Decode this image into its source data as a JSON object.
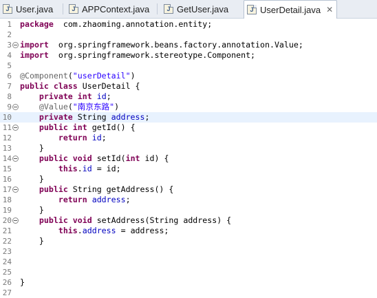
{
  "tabs": [
    {
      "label": "User.java",
      "active": false
    },
    {
      "label": "APPContext.java",
      "active": false
    },
    {
      "label": "GetUser.java",
      "active": false
    },
    {
      "label": "UserDetail.java",
      "active": true
    }
  ],
  "tab_icon_letter": "J",
  "close_glyph": "✕",
  "current_line": 10,
  "lines": [
    {
      "n": "1",
      "fold": false,
      "t": [
        [
          "kw",
          "package"
        ],
        [
          "",
          "  com.zhaoming.annotation.entity;"
        ]
      ]
    },
    {
      "n": "2",
      "fold": false,
      "t": []
    },
    {
      "n": "3",
      "fold": true,
      "t": [
        [
          "kw",
          "import"
        ],
        [
          "",
          "  org.springframework.beans.factory.annotation.Value;"
        ]
      ]
    },
    {
      "n": "4",
      "fold": false,
      "t": [
        [
          "kw",
          "import"
        ],
        [
          "",
          "  org.springframework.stereotype.Component;"
        ]
      ]
    },
    {
      "n": "5",
      "fold": false,
      "t": []
    },
    {
      "n": "6",
      "fold": false,
      "t": [
        [
          "ann",
          "@Component"
        ],
        [
          "",
          "("
        ],
        [
          "str",
          "\"userDetail\""
        ],
        [
          "",
          ")"
        ]
      ]
    },
    {
      "n": "7",
      "fold": false,
      "t": [
        [
          "kw",
          "public"
        ],
        [
          "",
          " "
        ],
        [
          "kw",
          "class"
        ],
        [
          "",
          " UserDetail {"
        ]
      ]
    },
    {
      "n": "8",
      "fold": false,
      "t": [
        [
          "",
          "    "
        ],
        [
          "kw",
          "private"
        ],
        [
          "",
          " "
        ],
        [
          "kw",
          "int"
        ],
        [
          "",
          " "
        ],
        [
          "fld",
          "id"
        ],
        [
          "",
          ";"
        ]
      ]
    },
    {
      "n": "9",
      "fold": true,
      "t": [
        [
          "",
          "    "
        ],
        [
          "ann",
          "@Value"
        ],
        [
          "",
          "("
        ],
        [
          "str",
          "\"南京东路\""
        ],
        [
          "",
          ")"
        ]
      ]
    },
    {
      "n": "10",
      "fold": false,
      "t": [
        [
          "",
          "    "
        ],
        [
          "kw",
          "private"
        ],
        [
          "",
          " String "
        ],
        [
          "fld",
          "address"
        ],
        [
          "",
          ";"
        ]
      ]
    },
    {
      "n": "11",
      "fold": true,
      "t": [
        [
          "",
          "    "
        ],
        [
          "kw",
          "public"
        ],
        [
          "",
          " "
        ],
        [
          "kw",
          "int"
        ],
        [
          "",
          " getId() {"
        ]
      ]
    },
    {
      "n": "12",
      "fold": false,
      "t": [
        [
          "",
          "        "
        ],
        [
          "kw",
          "return"
        ],
        [
          "",
          " "
        ],
        [
          "fld",
          "id"
        ],
        [
          "",
          ";"
        ]
      ]
    },
    {
      "n": "13",
      "fold": false,
      "t": [
        [
          "",
          "    }"
        ]
      ]
    },
    {
      "n": "14",
      "fold": true,
      "t": [
        [
          "",
          "    "
        ],
        [
          "kw",
          "public"
        ],
        [
          "",
          " "
        ],
        [
          "kw",
          "void"
        ],
        [
          "",
          " setId("
        ],
        [
          "kw",
          "int"
        ],
        [
          "",
          " id) {"
        ]
      ]
    },
    {
      "n": "15",
      "fold": false,
      "t": [
        [
          "",
          "        "
        ],
        [
          "kw",
          "this"
        ],
        [
          "",
          "."
        ],
        [
          "fld",
          "id"
        ],
        [
          "",
          " = id;"
        ]
      ]
    },
    {
      "n": "16",
      "fold": false,
      "t": [
        [
          "",
          "    }"
        ]
      ]
    },
    {
      "n": "17",
      "fold": true,
      "t": [
        [
          "",
          "    "
        ],
        [
          "kw",
          "public"
        ],
        [
          "",
          " String getAddress() {"
        ]
      ]
    },
    {
      "n": "18",
      "fold": false,
      "t": [
        [
          "",
          "        "
        ],
        [
          "kw",
          "return"
        ],
        [
          "",
          " "
        ],
        [
          "fld",
          "address"
        ],
        [
          "",
          ";"
        ]
      ]
    },
    {
      "n": "19",
      "fold": false,
      "t": [
        [
          "",
          "    }"
        ]
      ]
    },
    {
      "n": "20",
      "fold": true,
      "t": [
        [
          "",
          "    "
        ],
        [
          "kw",
          "public"
        ],
        [
          "",
          " "
        ],
        [
          "kw",
          "void"
        ],
        [
          "",
          " setAddress(String address) {"
        ]
      ]
    },
    {
      "n": "21",
      "fold": false,
      "t": [
        [
          "",
          "        "
        ],
        [
          "kw",
          "this"
        ],
        [
          "",
          "."
        ],
        [
          "fld",
          "address"
        ],
        [
          "",
          " = address;"
        ]
      ]
    },
    {
      "n": "22",
      "fold": false,
      "t": [
        [
          "",
          "    }"
        ]
      ]
    },
    {
      "n": "23",
      "fold": false,
      "t": []
    },
    {
      "n": "24",
      "fold": false,
      "t": []
    },
    {
      "n": "25",
      "fold": false,
      "t": []
    },
    {
      "n": "26",
      "fold": false,
      "t": [
        [
          "",
          "}"
        ]
      ]
    },
    {
      "n": "27",
      "fold": false,
      "t": []
    }
  ],
  "colors": {
    "keyword": "#7f0055",
    "annotation": "#646464",
    "string": "#2a00ff",
    "field": "#0000c0",
    "current_line_bg": "#e8f2fe"
  }
}
